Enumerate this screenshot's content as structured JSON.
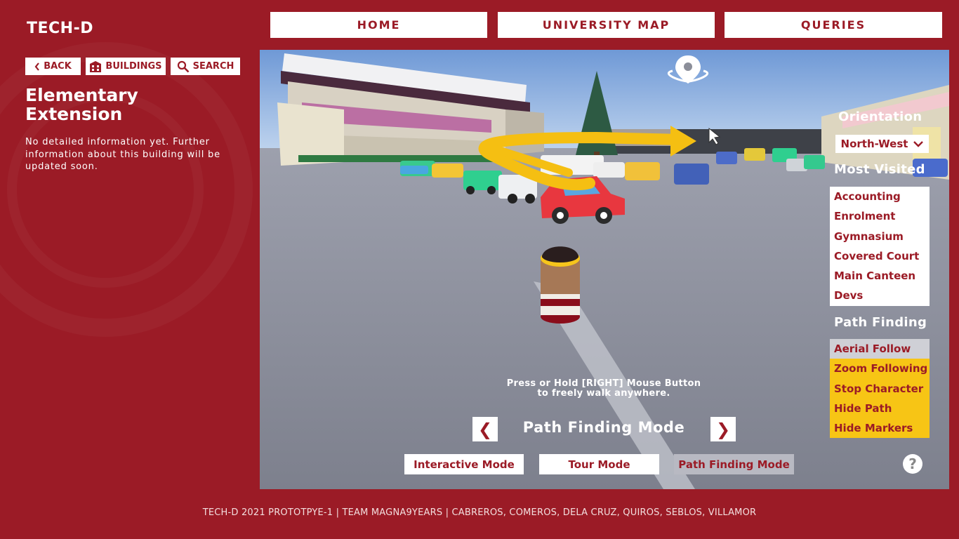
{
  "app": {
    "logo": "TECH-D"
  },
  "nav": {
    "home": "HOME",
    "map": "UNIVERSITY MAP",
    "queries": "QUERIES"
  },
  "toolbar": {
    "back": "BACK",
    "buildings": "BUILDINGS",
    "search": "SEARCH"
  },
  "building": {
    "title": "Elementary Extension",
    "description": "No detailed information yet. Further information about this building will be updated soon."
  },
  "sidebar": {
    "orientation_label": "Orientation",
    "orientation_value": "North-West",
    "most_visited_label": "Most Visited",
    "most_visited": [
      "Accounting",
      "Enrolment",
      "Gymnasium",
      "Covered Court",
      "Main Canteen",
      "Devs"
    ],
    "path_finding_label": "Path Finding",
    "path_finding_options": [
      "Aerial Follow",
      "Zoom Following",
      "Stop Character",
      "Hide Path",
      "Hide Markers"
    ]
  },
  "viewport": {
    "hint_line1": "Press or Hold [RIGHT] Mouse Button",
    "hint_line2": "to freely walk anywhere.",
    "mode_title": "Path Finding Mode",
    "prev_arrow": "❮",
    "next_arrow": "❯",
    "modes": [
      "Interactive Mode",
      "Tour Mode",
      "Path Finding Mode"
    ],
    "help": "?"
  },
  "colors": {
    "brand": "#9b1b26",
    "accent": "#f7c515",
    "path": "#f5bf12"
  },
  "footer": "TECH-D 2021 PROTOTPYE-1 | TEAM MAGNA9YEARS | CABREROS, COMEROS, DELA CRUZ, QUIROS, SEBLOS, VILLAMOR"
}
